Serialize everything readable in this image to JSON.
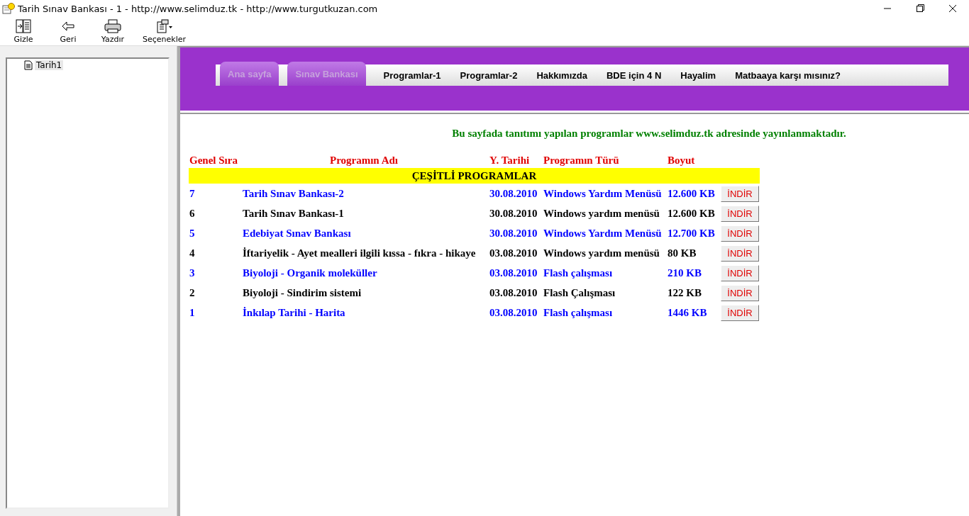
{
  "window": {
    "title": "Tarih Sınav Bankası - 1 - http://www.selimduz.tk -  http://www.turgutkuzan.com"
  },
  "toolbar": [
    {
      "label": "Gizle",
      "kind": "hide"
    },
    {
      "label": "Geri",
      "kind": "back"
    },
    {
      "label": "Yazdır",
      "kind": "print"
    },
    {
      "label": "Seçenekler",
      "kind": "options"
    }
  ],
  "tree": {
    "items": [
      {
        "label": "Tarih1",
        "selected": true
      }
    ]
  },
  "nav": [
    {
      "label": "Ana sayfa",
      "kind": "tab"
    },
    {
      "label": "Sınav Bankası",
      "kind": "tab"
    },
    {
      "label": "Programlar-1",
      "kind": "link"
    },
    {
      "label": "Programlar-2",
      "kind": "link"
    },
    {
      "label": "Hakkımızda",
      "kind": "link"
    },
    {
      "label": "BDE için 4 N",
      "kind": "link"
    },
    {
      "label": "Hayalim",
      "kind": "link"
    },
    {
      "label": "Matbaaya karşı mısınız?",
      "kind": "link"
    }
  ],
  "notice": "Bu sayfada tanıtımı yapılan programlar www.selimduz.tk adresinde yayınlanmaktadır.",
  "table": {
    "columns": [
      "Genel Sıra",
      "Programın Adı",
      "Y. Tarihi",
      "Programın Türü",
      "Boyut"
    ],
    "section": "ÇEŞİTLİ PROGRAMLAR",
    "rows": [
      {
        "no": "7",
        "name": "Tarih Sınav Bankası-2",
        "date": "30.08.2010",
        "type": "Windows Yardım Menüsü",
        "size": "12.600 KB",
        "button": "İNDİR",
        "color": "#0000ff"
      },
      {
        "no": "6",
        "name": "Tarih Sınav Bankası-1",
        "date": "30.08.2010",
        "type": "Windows yardım menüsü",
        "size": "12.600 KB",
        "button": "İNDİR",
        "color": "#000000"
      },
      {
        "no": "5",
        "name": "Edebiyat Sınav Bankası",
        "date": "30.08.2010",
        "type": "Windows Yardım Menüsü",
        "size": "12.700 KB",
        "button": "İNDİR",
        "color": "#0000ff"
      },
      {
        "no": "4",
        "name": "İftariyelik - Ayet mealleri ilgili kıssa - fıkra - hikaye",
        "date": "03.08.2010",
        "type": "Windows yardım menüsü",
        "size": "80 KB",
        "button": "İNDİR",
        "color": "#000000"
      },
      {
        "no": "3",
        "name": "Biyoloji - Organik moleküller",
        "date": "03.08.2010",
        "type": "Flash çalışması",
        "size": "210 KB",
        "button": "İNDİR",
        "color": "#0000ff"
      },
      {
        "no": "2",
        "name": "Biyoloji - Sindirim sistemi",
        "date": "03.08.2010",
        "type": "Flash Çalışması",
        "size": "122 KB",
        "button": "İNDİR",
        "color": "#000000"
      },
      {
        "no": "1",
        "name": "İnkılap Tarihi - Harita",
        "date": "03.08.2010",
        "type": "Flash çalışması",
        "size": "1446 KB",
        "button": "İNDİR",
        "color": "#0000ff"
      }
    ]
  }
}
